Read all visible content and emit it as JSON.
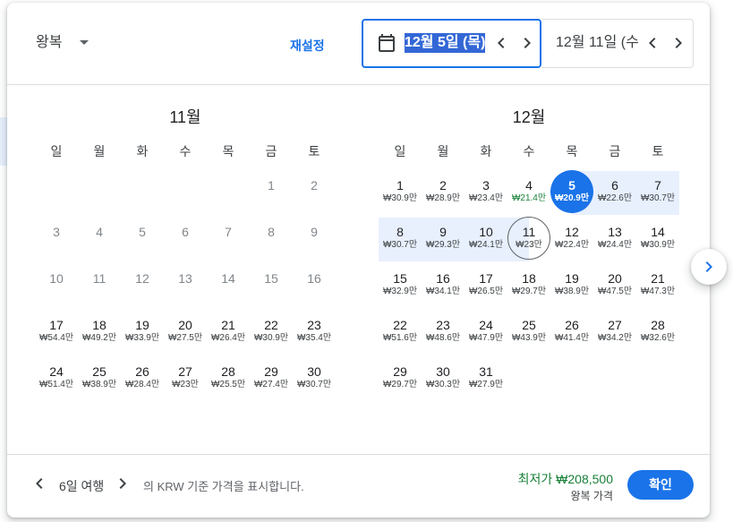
{
  "colors": {
    "accent": "#1a73e8",
    "selection": "#3367d6",
    "range_highlight": "#e8f0fe",
    "low_price": "#188038",
    "text": "#3c4043",
    "disabled": "#80868b",
    "divider": "#dadce0"
  },
  "icons": {
    "trip_type_dropdown": "dropdown-arrow-icon",
    "date_field": "calendar-icon",
    "previous": "chevron-left-icon",
    "next": "chevron-right-icon",
    "next_month": "chevron-right-icon"
  },
  "header": {
    "trip_type": "왕복",
    "reset": "재설정",
    "departure_date": "12월 5일 (목)",
    "return_date": "12월 11일 (수"
  },
  "calendar": {
    "weekdays": [
      "일",
      "월",
      "화",
      "수",
      "목",
      "금",
      "토"
    ],
    "months": [
      {
        "title": "11월",
        "weeks": [
          [
            null,
            null,
            null,
            null,
            null,
            {
              "day": 1,
              "disabled": true
            },
            {
              "day": 2,
              "disabled": true
            }
          ],
          [
            {
              "day": 3,
              "disabled": true
            },
            {
              "day": 4,
              "disabled": true
            },
            {
              "day": 5,
              "disabled": true
            },
            {
              "day": 6,
              "disabled": true
            },
            {
              "day": 7,
              "disabled": true
            },
            {
              "day": 8,
              "disabled": true
            },
            {
              "day": 9,
              "disabled": true
            }
          ],
          [
            {
              "day": 10,
              "disabled": true
            },
            {
              "day": 11,
              "disabled": true
            },
            {
              "day": 12,
              "disabled": true
            },
            {
              "day": 13,
              "disabled": true
            },
            {
              "day": 14,
              "disabled": true
            },
            {
              "day": 15,
              "disabled": true
            },
            {
              "day": 16,
              "disabled": true
            }
          ],
          [
            {
              "day": 17,
              "price": "₩54.4만"
            },
            {
              "day": 18,
              "price": "₩49.2만"
            },
            {
              "day": 19,
              "price": "₩33.9만"
            },
            {
              "day": 20,
              "price": "₩27.5만"
            },
            {
              "day": 21,
              "price": "₩26.4만"
            },
            {
              "day": 22,
              "price": "₩30.9만"
            },
            {
              "day": 23,
              "price": "₩35.4만"
            }
          ],
          [
            {
              "day": 24,
              "price": "₩51.4만"
            },
            {
              "day": 25,
              "price": "₩38.9만"
            },
            {
              "day": 26,
              "price": "₩28.4만"
            },
            {
              "day": 27,
              "price": "₩23만"
            },
            {
              "day": 28,
              "price": "₩25.5만"
            },
            {
              "day": 29,
              "price": "₩27.4만"
            },
            {
              "day": 30,
              "price": "₩30.7만"
            }
          ]
        ]
      },
      {
        "title": "12월",
        "weeks": [
          [
            {
              "day": 1,
              "price": "₩30.9만"
            },
            {
              "day": 2,
              "price": "₩28.9만"
            },
            {
              "day": 3,
              "price": "₩23.4만"
            },
            {
              "day": 4,
              "price": "₩21.4만",
              "low_price": true
            },
            {
              "day": 5,
              "price": "₩20.9만",
              "range_start": true
            },
            {
              "day": 6,
              "price": "₩22.6만",
              "in_range": true
            },
            {
              "day": 7,
              "price": "₩30.7만",
              "in_range": true
            }
          ],
          [
            {
              "day": 8,
              "price": "₩30.7만",
              "in_range": true
            },
            {
              "day": 9,
              "price": "₩29.3만",
              "in_range": true
            },
            {
              "day": 10,
              "price": "₩24.1만",
              "in_range": true
            },
            {
              "day": 11,
              "price": "₩23만",
              "range_end": true
            },
            {
              "day": 12,
              "price": "₩22.4만"
            },
            {
              "day": 13,
              "price": "₩24.4만"
            },
            {
              "day": 14,
              "price": "₩30.9만"
            }
          ],
          [
            {
              "day": 15,
              "price": "₩32.9만"
            },
            {
              "day": 16,
              "price": "₩34.1만"
            },
            {
              "day": 17,
              "price": "₩26.5만"
            },
            {
              "day": 18,
              "price": "₩29.7만"
            },
            {
              "day": 19,
              "price": "₩38.9만"
            },
            {
              "day": 20,
              "price": "₩47.5만"
            },
            {
              "day": 21,
              "price": "₩47.3만"
            }
          ],
          [
            {
              "day": 22,
              "price": "₩51.6만"
            },
            {
              "day": 23,
              "price": "₩48.6만"
            },
            {
              "day": 24,
              "price": "₩47.9만"
            },
            {
              "day": 25,
              "price": "₩43.9만"
            },
            {
              "day": 26,
              "price": "₩41.4만"
            },
            {
              "day": 27,
              "price": "₩34.2만"
            },
            {
              "day": 28,
              "price": "₩32.6만"
            }
          ],
          [
            {
              "day": 29,
              "price": "₩29.7만"
            },
            {
              "day": 30,
              "price": "₩30.3만"
            },
            {
              "day": 31,
              "price": "₩27.9만"
            },
            null,
            null,
            null,
            null
          ]
        ]
      }
    ]
  },
  "footer": {
    "trip_length": "6일 여행",
    "currency_note": "의 KRW 기준 가격을 표시합니다.",
    "lowest_price": "최저가 ₩208,500",
    "price_type": "왕복 가격",
    "confirm": "확인"
  }
}
